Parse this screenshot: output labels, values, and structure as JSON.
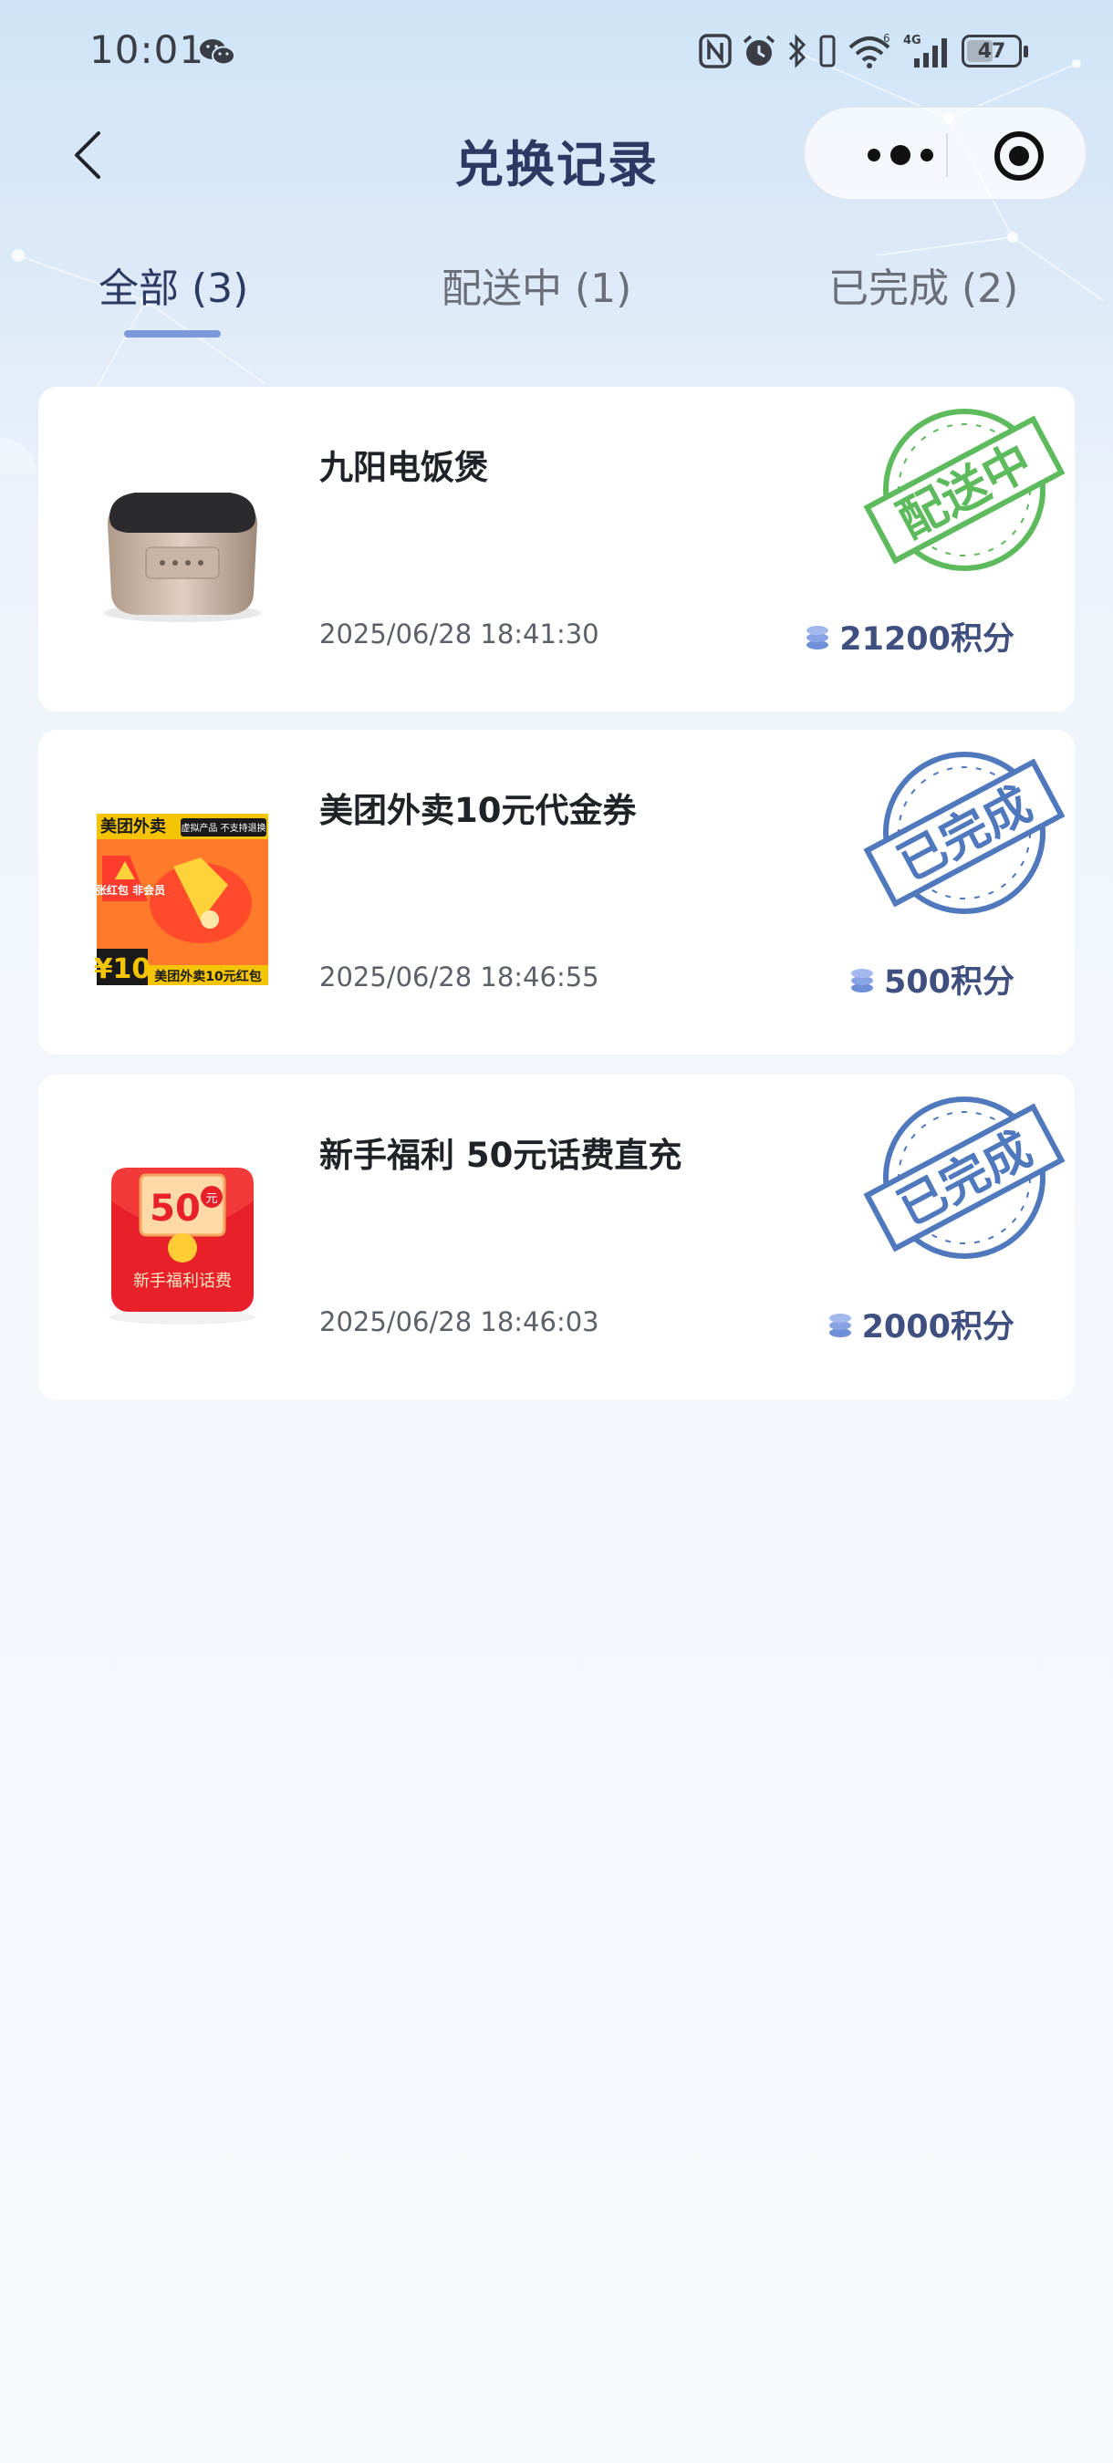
{
  "status_bar": {
    "time": "10:01",
    "battery_level": "47",
    "network_label": "4G",
    "wifi_badge": "6"
  },
  "header": {
    "title": "兑换记录"
  },
  "tabs": [
    {
      "label": "全部 (3)",
      "active": true
    },
    {
      "label": "配送中 (1)",
      "active": false
    },
    {
      "label": "已完成 (2)",
      "active": false
    }
  ],
  "orders": [
    {
      "name": "九阳电饭煲",
      "time": "2025/06/28 18:41:30",
      "points": "21200积分",
      "status": "配送中",
      "status_color": "#5dbb5d",
      "icon": "rice-cooker-image"
    },
    {
      "name": "美团外卖10元代金券",
      "time": "2025/06/28 18:46:55",
      "points": "500积分",
      "status": "已完成",
      "status_color": "#4f78bd",
      "icon": "meituan-coupon-image",
      "image_text": {
        "brand": "美团外卖",
        "tag": "虚拟产品 不支持退换",
        "badge": "单张红包 非会员",
        "value": "¥10",
        "caption": "美团外卖10元红包"
      }
    },
    {
      "name": "新手福利 50元话费直充",
      "time": "2025/06/28 18:46:03",
      "points": "2000积分",
      "status": "已完成",
      "status_color": "#4f78bd",
      "icon": "red-envelope-image",
      "image_text": {
        "amount": "50",
        "unit": "元",
        "caption": "新手福利话费"
      }
    }
  ],
  "colors": {
    "title": "#2c3a63",
    "tab_active_underline": "#7d99da",
    "points_text": "#3f4f80",
    "background_top": "#cfe4f8"
  }
}
